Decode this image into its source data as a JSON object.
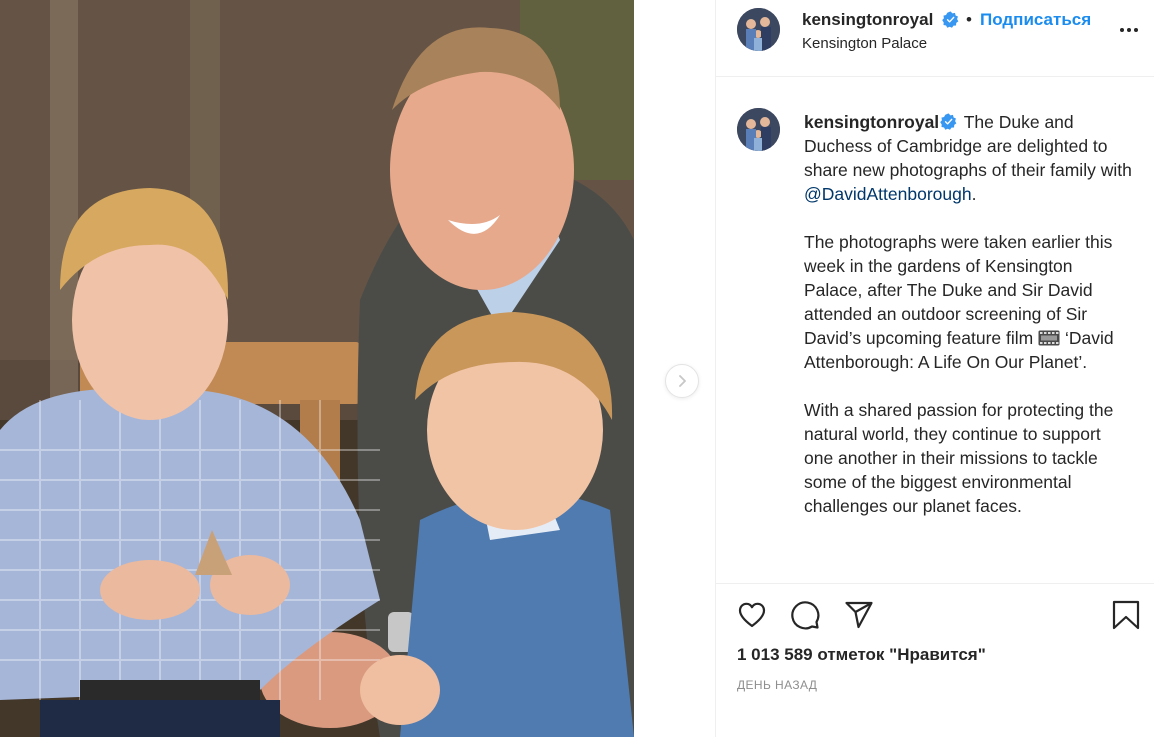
{
  "post": {
    "username": "kensingtonroyal",
    "follow_label": "Подписаться",
    "separator": "•",
    "location": "Kensington Palace",
    "caption": {
      "username": "kensingtonroyal",
      "p1_text": "The Duke and Duchess of Cambridge are delighted to share new photographs of their family with",
      "p1_mention": "@DavidAttenborough",
      "p1_end": ".",
      "p2_text": "The photographs were taken earlier this week in the gardens of Kensington Palace, after The Duke and Sir David attended an outdoor screening of Sir David’s upcoming feature film",
      "p2_emoji": "film-frames-icon",
      "p2_end": "‘David Attenborough: A Life On Our Planet’.",
      "p3": "With a shared passion for protecting the natural world, they continue to support one another in their missions to tackle some of the biggest environmental challenges our planet faces."
    },
    "likes": "1 013 589 отметок \"Нравится\"",
    "time": "ДЕНЬ НАЗАД"
  },
  "icons": {
    "verified": "verified-badge-icon",
    "more": "more-options-icon",
    "like": "heart-icon",
    "comment": "comment-icon",
    "share": "paper-plane-icon",
    "save": "bookmark-icon",
    "next": "chevron-right-icon"
  },
  "colors": {
    "follow": "#1a8cf0",
    "verified": "#3897f0",
    "mention": "#00376b",
    "muted": "#8e8e8e",
    "text": "#262626"
  }
}
